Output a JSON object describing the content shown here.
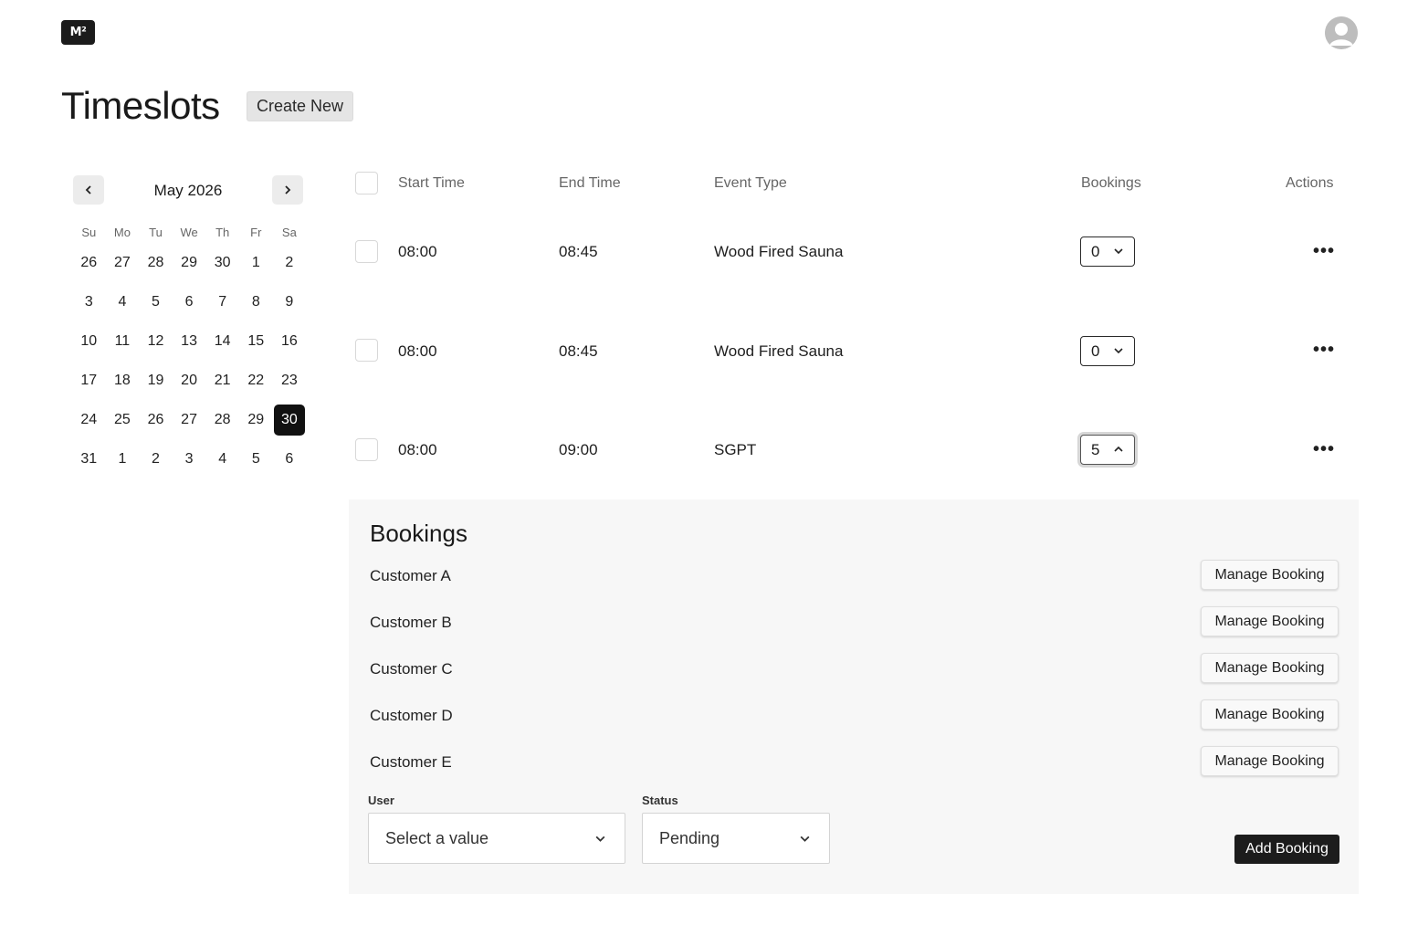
{
  "header": {
    "logo_text": "M²",
    "avatar_icon": "user-avatar-icon"
  },
  "page": {
    "title": "Timeslots",
    "create_new_label": "Create New"
  },
  "calendar": {
    "month_label": "May 2026",
    "prev_icon": "chevron-left-icon",
    "next_icon": "chevron-right-icon",
    "weekdays": [
      "Su",
      "Mo",
      "Tu",
      "We",
      "Th",
      "Fr",
      "Sa"
    ],
    "days": [
      "26",
      "27",
      "28",
      "29",
      "30",
      "1",
      "2",
      "3",
      "4",
      "5",
      "6",
      "7",
      "8",
      "9",
      "10",
      "11",
      "12",
      "13",
      "14",
      "15",
      "16",
      "17",
      "18",
      "19",
      "20",
      "21",
      "22",
      "23",
      "24",
      "25",
      "26",
      "27",
      "28",
      "29",
      "30",
      "31",
      "1",
      "2",
      "3",
      "4",
      "5",
      "6"
    ],
    "selected_index": 34
  },
  "table": {
    "headers": {
      "start_time": "Start Time",
      "end_time": "End Time",
      "event_type": "Event Type",
      "bookings": "Bookings",
      "actions": "Actions"
    },
    "rows": [
      {
        "start": "08:00",
        "end": "08:45",
        "event": "Wood Fired Sauna",
        "bookings": "0",
        "expanded": false
      },
      {
        "start": "08:00",
        "end": "08:45",
        "event": "Wood Fired Sauna",
        "bookings": "0",
        "expanded": false
      },
      {
        "start": "08:00",
        "end": "09:00",
        "event": "SGPT",
        "bookings": "5",
        "expanded": true
      }
    ],
    "more_label": "•••"
  },
  "bookings_panel": {
    "title": "Bookings",
    "customers": [
      {
        "name": "Customer A",
        "action": "Manage Booking"
      },
      {
        "name": "Customer B",
        "action": "Manage Booking"
      },
      {
        "name": "Customer C",
        "action": "Manage Booking"
      },
      {
        "name": "Customer D",
        "action": "Manage Booking"
      },
      {
        "name": "Customer E",
        "action": "Manage Booking"
      }
    ],
    "user_label": "User",
    "user_placeholder": "Select a value",
    "status_label": "Status",
    "status_value": "Pending",
    "add_booking_label": "Add Booking"
  }
}
